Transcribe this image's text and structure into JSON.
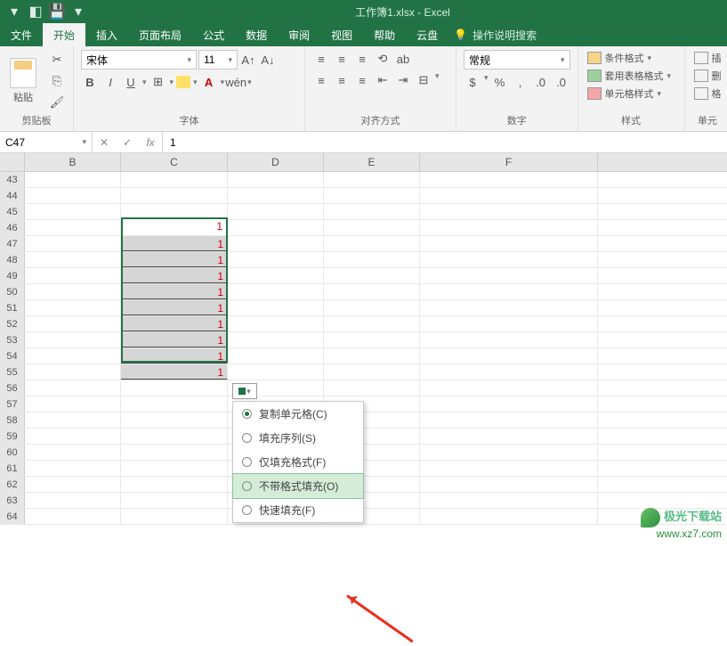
{
  "title": "工作簿1.xlsx - Excel",
  "tabs": [
    "文件",
    "开始",
    "插入",
    "页面布局",
    "公式",
    "数据",
    "审阅",
    "视图",
    "帮助",
    "云盘"
  ],
  "tell_me": "操作说明搜索",
  "ribbon": {
    "clipboard": {
      "paste": "粘贴",
      "label": "剪贴板"
    },
    "font": {
      "name": "宋体",
      "size": "11",
      "label": "字体",
      "bold": "B",
      "italic": "I",
      "underline": "U",
      "wen": "wén"
    },
    "align": {
      "label": "对齐方式",
      "wrap": "ab"
    },
    "number": {
      "format": "常规",
      "label": "数字"
    },
    "styles": {
      "label": "样式",
      "cond": "条件格式",
      "tbl": "套用表格格式",
      "cell": "单元格样式"
    },
    "cells": {
      "insert": "插",
      "delete": "删",
      "format": "格",
      "label": "单元"
    }
  },
  "name_box": "C47",
  "fx": "fx",
  "formula_value": "1",
  "columns": [
    "B",
    "C",
    "D",
    "E",
    "F"
  ],
  "row_start": 43,
  "cell_fill_value": "1",
  "autofill": {
    "items": [
      {
        "label": "复制单元格(C)",
        "selected": true,
        "hl": false
      },
      {
        "label": "填充序列(S)",
        "selected": false,
        "hl": false
      },
      {
        "label": "仅填充格式(F)",
        "selected": false,
        "hl": false
      },
      {
        "label": "不带格式填充(O)",
        "selected": false,
        "hl": true
      },
      {
        "label": "快速填充(F)",
        "selected": false,
        "hl": false
      }
    ]
  },
  "watermark": {
    "line1": "极光下载站",
    "line2": "www.xz7.com"
  }
}
